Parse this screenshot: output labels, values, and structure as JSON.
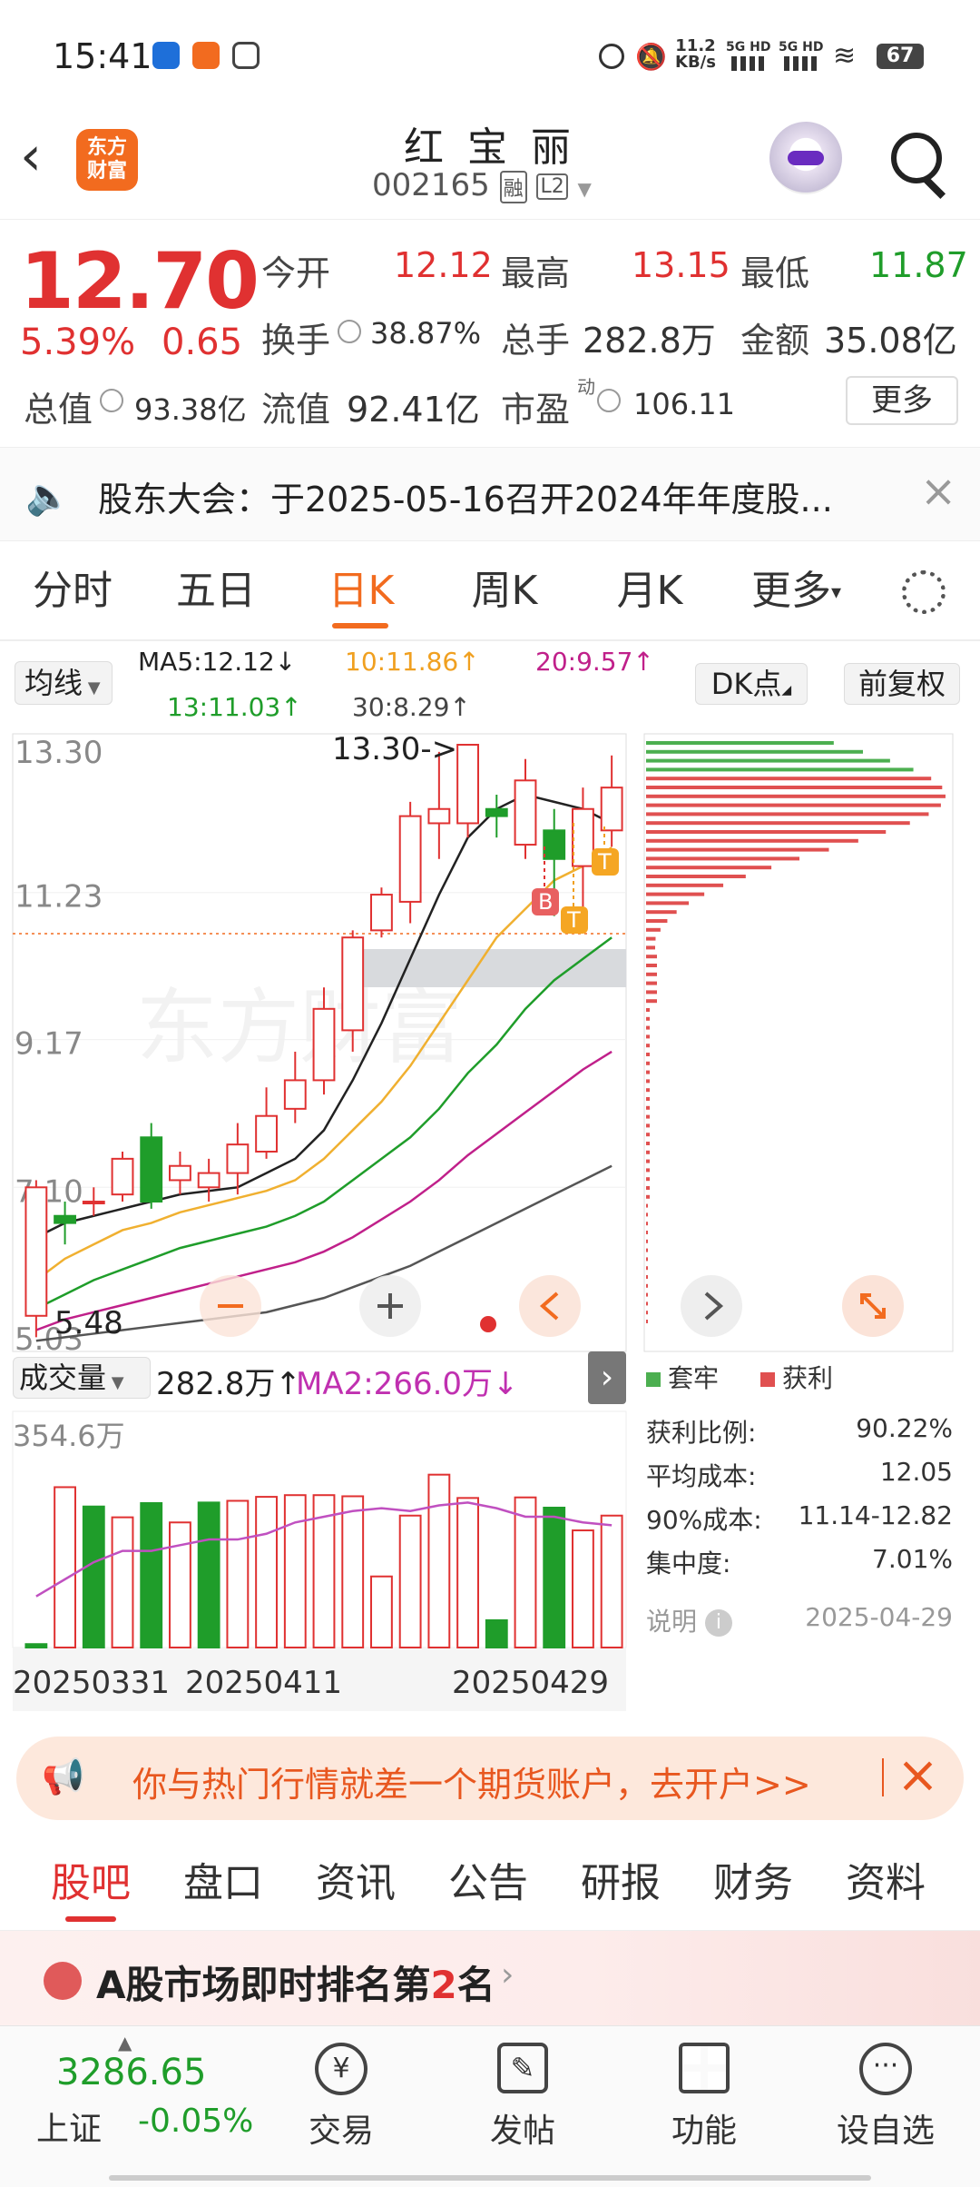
{
  "status": {
    "time": "15:41",
    "net_speed_top": "11.2",
    "net_speed_bottom": "KB/s",
    "signal1": "5G HD",
    "signal2": "5G HD",
    "battery": "67"
  },
  "header": {
    "stock_name": "红 宝 丽",
    "stock_code": "002165",
    "badge_rong": "融",
    "badge_l2": "L2",
    "logo_line1": "东方",
    "logo_line2": "财富"
  },
  "quote": {
    "price": "12.70",
    "change_pct": "5.39%",
    "change_amt": "0.65",
    "open_label": "今开",
    "open": "12.12",
    "high_label": "最高",
    "high": "13.15",
    "low_label": "最低",
    "low": "11.87",
    "turnover_label": "换手",
    "turnover": "38.87%",
    "volume_label": "总手",
    "volume": "282.8万",
    "amount_label": "金额",
    "amount": "35.08亿",
    "mktcap_label": "总值",
    "mktcap": "93.38亿",
    "float_label": "流值",
    "float_cap": "92.41亿",
    "pe_label": "市盈",
    "pe_sup": "动",
    "pe": "106.11",
    "more": "更多"
  },
  "notice": {
    "text": "股东大会：于2025-05-16召开2024年年度股..."
  },
  "tabs": [
    "分时",
    "五日",
    "日K",
    "周K",
    "月K",
    "更多"
  ],
  "active_tab": 2,
  "chart": {
    "ma_selector": "均线",
    "ma5": "MA5:12.12",
    "ma10": "10:11.86",
    "ma20": "20:9.57",
    "ma30": "30:8.29",
    "ma13": "13:11.03",
    "dk_button": "DK点",
    "fq_button": "前复权",
    "y_labels": [
      "13.30",
      "11.23",
      "9.17",
      "7.10",
      "5.03"
    ],
    "high_marker": "13.30->",
    "low_marker": "5.48",
    "vol_selector": "成交量",
    "vol_value": "282.8万",
    "vol_ma2": "MA2:266.0万",
    "vol_max": "354.6万",
    "dates": [
      "20250331",
      "20250411",
      "20250429"
    ],
    "badge_b": "B",
    "badge_t": "T",
    "watermark": "东方财富"
  },
  "chart_data": {
    "type": "candlestick",
    "candles": [
      {
        "o": 5.3,
        "c": 7.1,
        "h": 7.2,
        "l": 5.0
      },
      {
        "o": 6.7,
        "c": 6.6,
        "h": 6.9,
        "l": 6.3
      },
      {
        "o": 6.9,
        "c": 6.9,
        "h": 7.1,
        "l": 6.7
      },
      {
        "o": 7.0,
        "c": 7.5,
        "h": 7.6,
        "l": 6.9
      },
      {
        "o": 7.8,
        "c": 6.9,
        "h": 8.0,
        "l": 6.8
      },
      {
        "o": 7.2,
        "c": 7.4,
        "h": 7.6,
        "l": 7.0
      },
      {
        "o": 7.1,
        "c": 7.3,
        "h": 7.5,
        "l": 6.9
      },
      {
        "o": 7.3,
        "c": 7.7,
        "h": 8.0,
        "l": 7.0
      },
      {
        "o": 7.6,
        "c": 8.1,
        "h": 8.5,
        "l": 7.5
      },
      {
        "o": 8.2,
        "c": 8.6,
        "h": 9.0,
        "l": 8.0
      },
      {
        "o": 8.6,
        "c": 9.6,
        "h": 9.9,
        "l": 8.4
      },
      {
        "o": 9.3,
        "c": 10.6,
        "h": 10.7,
        "l": 9.0
      },
      {
        "o": 10.7,
        "c": 11.2,
        "h": 11.3,
        "l": 10.6
      },
      {
        "o": 11.1,
        "c": 12.3,
        "h": 12.5,
        "l": 10.8
      },
      {
        "o": 12.2,
        "c": 12.4,
        "h": 13.2,
        "l": 11.7
      },
      {
        "o": 12.2,
        "c": 13.3,
        "h": 13.3,
        "l": 12.0
      },
      {
        "o": 12.4,
        "c": 12.3,
        "h": 12.6,
        "l": 12.0
      },
      {
        "o": 11.9,
        "c": 12.8,
        "h": 13.1,
        "l": 11.7
      },
      {
        "o": 12.1,
        "c": 11.7,
        "h": 12.4,
        "l": 10.9
      },
      {
        "o": 11.6,
        "c": 12.4,
        "h": 12.7,
        "l": 10.7
      },
      {
        "o": 12.1,
        "c": 12.7,
        "h": 13.15,
        "l": 11.87
      }
    ],
    "ma_lines": [
      {
        "name": "MA5",
        "color": "#222222",
        "values": [
          6.4,
          6.6,
          6.7,
          6.8,
          6.9,
          7.0,
          7.05,
          7.1,
          7.3,
          7.5,
          7.9,
          8.6,
          9.4,
          10.3,
          11.2,
          12.0,
          12.4,
          12.6,
          12.5,
          12.4,
          12.2
        ]
      },
      {
        "name": "MA10",
        "color": "#f0b030",
        "values": [
          5.8,
          6.1,
          6.3,
          6.5,
          6.6,
          6.75,
          6.85,
          6.95,
          7.05,
          7.2,
          7.5,
          7.9,
          8.3,
          8.8,
          9.4,
          10.0,
          10.6,
          11.0,
          11.4,
          11.6,
          11.86
        ]
      },
      {
        "name": "MA20",
        "color": "#1f9d2a",
        "values": [
          5.4,
          5.6,
          5.8,
          5.95,
          6.1,
          6.25,
          6.35,
          6.45,
          6.55,
          6.7,
          6.9,
          7.2,
          7.5,
          7.8,
          8.2,
          8.7,
          9.1,
          9.6,
          10.0,
          10.3,
          10.6
        ]
      },
      {
        "name": "MA60",
        "color": "#c0208a",
        "values": [
          5.1,
          5.25,
          5.35,
          5.45,
          5.55,
          5.65,
          5.75,
          5.85,
          5.95,
          6.05,
          6.2,
          6.4,
          6.65,
          6.9,
          7.2,
          7.55,
          7.85,
          8.15,
          8.45,
          8.75,
          9.0
        ]
      },
      {
        "name": "MA120",
        "color": "#555555",
        "values": [
          4.95,
          5.0,
          5.05,
          5.1,
          5.15,
          5.2,
          5.25,
          5.3,
          5.35,
          5.45,
          5.55,
          5.7,
          5.85,
          6.0,
          6.2,
          6.4,
          6.6,
          6.8,
          7.0,
          7.2,
          7.4
        ]
      }
    ],
    "volume": [
      {
        "v": 6,
        "up": false
      },
      {
        "v": 282,
        "up": true
      },
      {
        "v": 248,
        "up": false
      },
      {
        "v": 229,
        "up": true
      },
      {
        "v": 254,
        "up": false
      },
      {
        "v": 220,
        "up": true
      },
      {
        "v": 255,
        "up": false
      },
      {
        "v": 258,
        "up": true
      },
      {
        "v": 265,
        "up": true
      },
      {
        "v": 268,
        "up": true
      },
      {
        "v": 268,
        "up": true
      },
      {
        "v": 266,
        "up": true
      },
      {
        "v": 125,
        "up": true
      },
      {
        "v": 232,
        "up": true
      },
      {
        "v": 304,
        "up": true
      },
      {
        "v": 263,
        "up": true
      },
      {
        "v": 48,
        "up": false
      },
      {
        "v": 264,
        "up": true
      },
      {
        "v": 246,
        "up": false
      },
      {
        "v": 206,
        "up": true
      },
      {
        "v": 232,
        "up": true
      }
    ],
    "volume_ma2": [
      90,
      120,
      150,
      170,
      170,
      180,
      190,
      190,
      200,
      220,
      230,
      240,
      245,
      240,
      250,
      255,
      245,
      230,
      230,
      220,
      215
    ],
    "ylim": [
      5.03,
      13.3
    ],
    "vol_max": 354.6
  },
  "cost": {
    "legend_trapped": "套牢",
    "legend_profit": "获利",
    "rows": [
      {
        "label": "获利比例:",
        "value": "90.22%"
      },
      {
        "label": "平均成本:",
        "value": "12.05"
      },
      {
        "label": "90%成本:",
        "value": "11.14-12.82"
      },
      {
        "label": "集中度:",
        "value": "7.01%"
      }
    ],
    "note_label": "说明",
    "date": "2025-04-29"
  },
  "promo": {
    "text": "你与热门行情就差一个期货账户，去开户>>"
  },
  "bottom_tabs": [
    "股吧",
    "盘口",
    "资讯",
    "公告",
    "研报",
    "财务",
    "资料"
  ],
  "rank": {
    "prefix": "A股市场即时排名第",
    "rank": "2",
    "suffix": "名"
  },
  "nav": {
    "index_value": "3286.65",
    "index_name": "上证",
    "index_change": "-0.05%",
    "items": [
      "交易",
      "发帖",
      "功能",
      "设自选"
    ]
  },
  "colors": {
    "up": "#e03131",
    "down": "#1f9d2a",
    "accent": "#f26b1f"
  }
}
